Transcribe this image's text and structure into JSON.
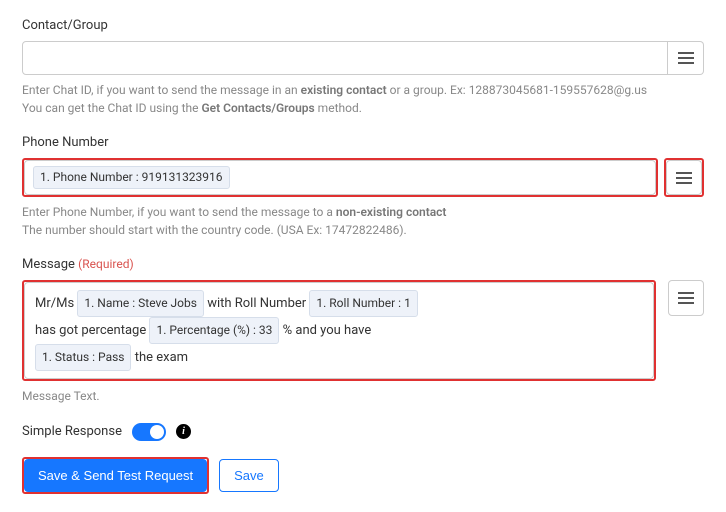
{
  "contactGroup": {
    "label": "Contact/Group",
    "value": "",
    "help_prefix": "Enter Chat ID, if you want to send the message in an ",
    "help_bold1": "existing contact",
    "help_mid": " or a group. Ex: 128873045681-159557628@g.us",
    "help_line2_prefix": "You can get the Chat ID using the ",
    "help_line2_bold": "Get Contacts/Groups",
    "help_line2_suffix": " method."
  },
  "phoneNumber": {
    "label": "Phone Number",
    "token": "1. Phone Number : 919131323916",
    "help_prefix": "Enter Phone Number, if you want to send the message to a ",
    "help_bold": "non-existing contact",
    "help_line2": "The number should start with the country code. (USA Ex: 17472822486)."
  },
  "message": {
    "label": "Message",
    "required": "(Required)",
    "text1": "Mr/Ms",
    "token_name": "1. Name : Steve Jobs",
    "text2": "with Roll Number",
    "token_roll": "1. Roll Number : 1",
    "text3": "has got percentage",
    "token_pct": "1. Percentage (%) : 33",
    "text4": "% and you have",
    "token_status": "1. Status : Pass",
    "text5": "the exam",
    "help": "Message Text."
  },
  "simpleResponse": {
    "label": "Simple Response"
  },
  "buttons": {
    "saveSend": "Save & Send Test Request",
    "save": "Save"
  }
}
